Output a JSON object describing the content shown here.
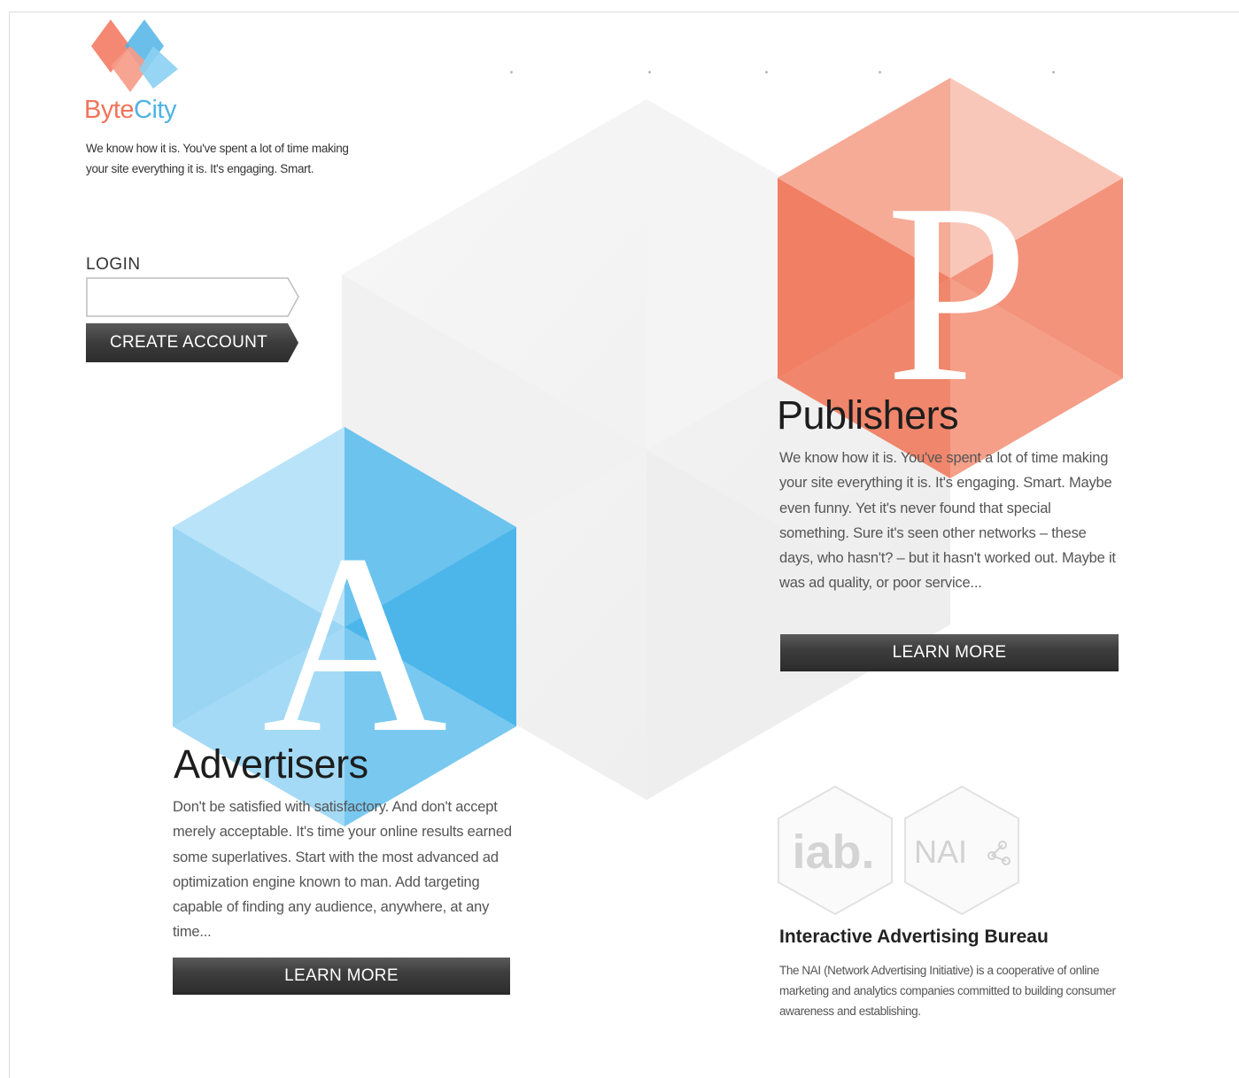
{
  "brand": {
    "name_part1": "Byte",
    "name_part2": "City",
    "tagline": "We know how it is. You've spent a lot of time making your site everything it is. It's engaging. Smart."
  },
  "login": {
    "label": "LOGIN",
    "value": "",
    "placeholder": ""
  },
  "create_account": {
    "label": "CREATE ACCOUNT"
  },
  "publishers": {
    "letter": "P",
    "title": "Publishers",
    "body": "We know how it is. You've spent a lot of time making your site everything it is. It's engaging. Smart. Maybe even funny. Yet it's never found that special something. Sure it's seen other networks – these days, who hasn't? – but it hasn't worked out. Maybe it was ad quality, or poor service...",
    "button": "LEARN MORE"
  },
  "advertisers": {
    "letter": "A",
    "title": "Advertisers",
    "body": "Don't be satisfied with satisfactory. And don't accept merely acceptable. It's time your online results earned some superlatives. Start with the most advanced ad optimization engine known to man. Add targeting capable of finding any audience, anywhere, at any time...",
    "button": "LEARN MORE"
  },
  "badges": {
    "iab": "iab.",
    "nai": "NAI"
  },
  "iab_section": {
    "title": "Interactive Advertising Bureau",
    "body": "The NAI (Network Advertising Initiative) is a cooperative of online marketing and analytics companies committed to building consumer awareness and establishing."
  },
  "colors": {
    "brand_red": "#f2735a",
    "brand_blue": "#4fb3e6",
    "button_dark": "#3a3a3a"
  },
  "icons": {
    "logo": "diamond-logo-icon",
    "badge_iab": "iab-hexagon-badge-icon",
    "badge_nai": "nai-hexagon-badge-icon"
  }
}
